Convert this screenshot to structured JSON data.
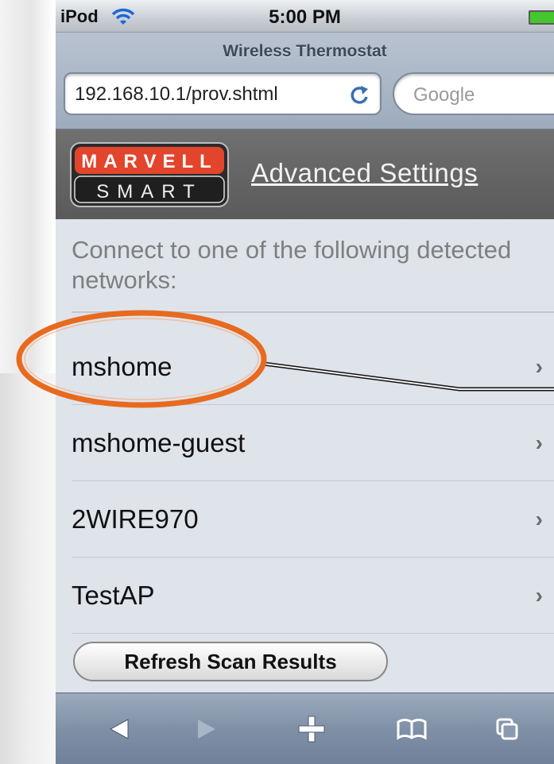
{
  "status_bar": {
    "carrier": "iPod",
    "time": "5:00 PM"
  },
  "safari": {
    "page_title": "Wireless Thermostat",
    "url": "192.168.10.1/prov.shtml",
    "search_placeholder": "Google"
  },
  "header": {
    "logo_top": "MARVELL",
    "logo_bottom": "SMART",
    "link": "Advanced Settings"
  },
  "content": {
    "intro": "Connect to one of the following detected networks:",
    "networks": [
      {
        "label": "mshome"
      },
      {
        "label": "mshome-guest"
      },
      {
        "label": "2WIRE970"
      },
      {
        "label": "TestAP"
      }
    ],
    "refresh_button": "Refresh Scan Results"
  },
  "toolbar": {
    "items": [
      "back-icon",
      "forward-icon",
      "add-bookmark-icon",
      "bookmarks-icon",
      "pages-icon"
    ]
  },
  "colors": {
    "annotation": "#e86a1e",
    "header_bg": "#666666",
    "logo_red": "#e2452c"
  }
}
